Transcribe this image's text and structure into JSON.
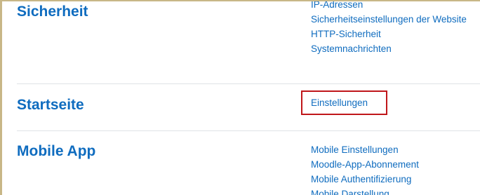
{
  "sections": [
    {
      "title": "Sicherheit",
      "links": [
        "IP-Adressen",
        "Sicherheitseinstellungen der Website",
        "HTTP-Sicherheit",
        "Systemnachrichten"
      ]
    },
    {
      "title": "Startseite",
      "links": [
        "Einstellungen"
      ]
    },
    {
      "title": "Mobile App",
      "links": [
        "Mobile Einstellungen",
        "Moodle-App-Abonnement",
        "Mobile Authentifizierung",
        "Mobile Darstellung"
      ]
    }
  ],
  "colors": {
    "link": "#0f6cbf",
    "heading": "#0f6cbf",
    "highlight_border": "#c0161a",
    "divider": "#dee2e6",
    "frame": "#c8b787"
  }
}
